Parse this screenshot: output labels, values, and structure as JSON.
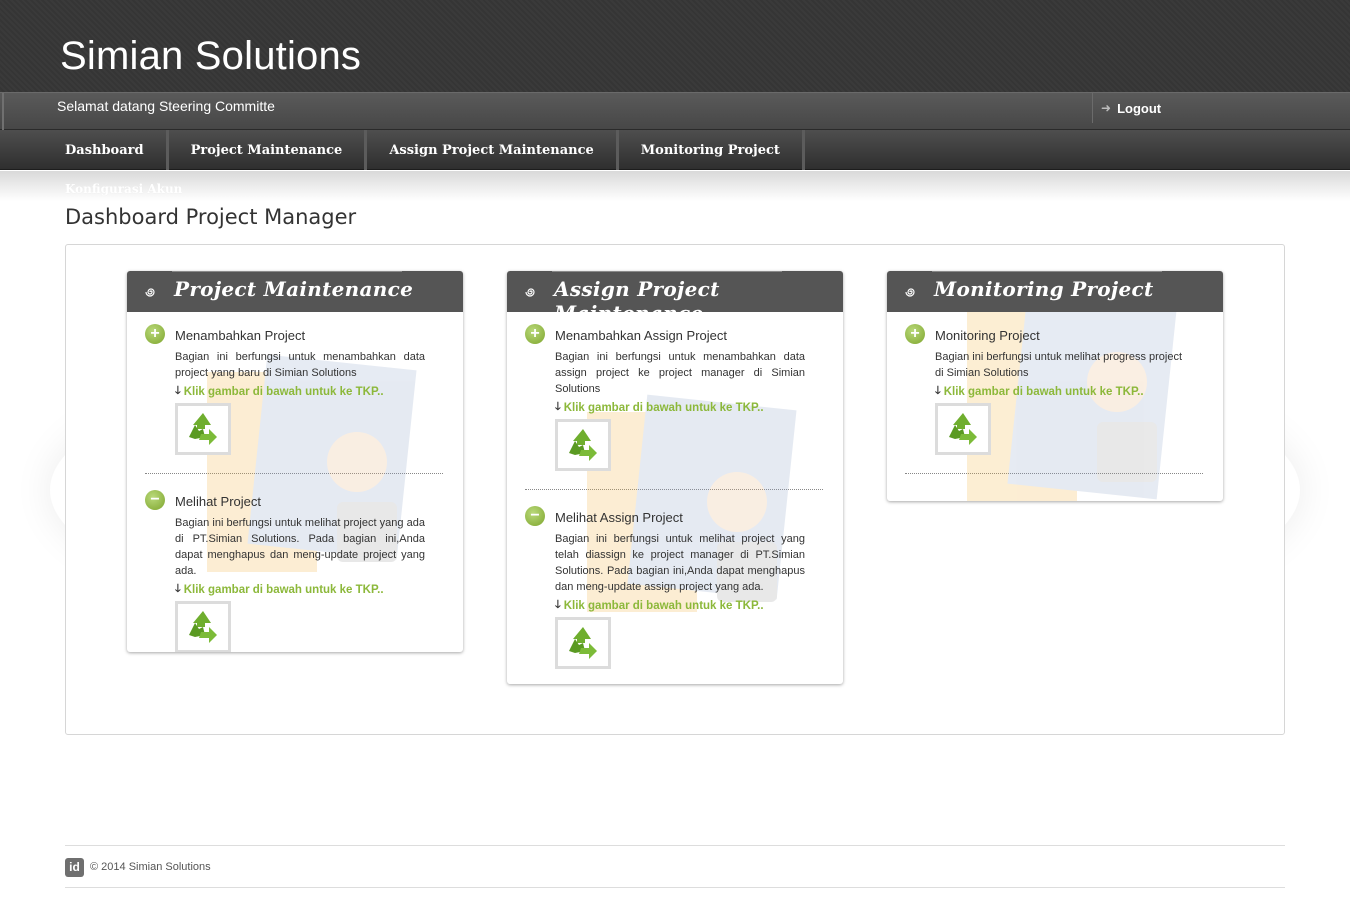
{
  "header": {
    "site_title": "Simian Solutions",
    "welcome": "Selamat datang Steering Committe",
    "logout_label": "Logout"
  },
  "nav": {
    "items": [
      {
        "label": "Dashboard"
      },
      {
        "label": "Project Maintenance"
      },
      {
        "label": "Assign Project Maintenance"
      },
      {
        "label": "Monitoring Project"
      }
    ],
    "submenu": "Konfigurasi Akun"
  },
  "page": {
    "title": "Dashboard Project Manager"
  },
  "panels": [
    {
      "title": "Project Maintenance",
      "sections": [
        {
          "icon": "plus",
          "title": "Menambahkan Project",
          "desc": "Bagian ini berfungsi untuk menambahkan data project yang baru di Simian Solutions",
          "link": "Klik gambar di bawah untuk ke TKP.."
        },
        {
          "icon": "minus",
          "title": "Melihat Project",
          "desc": "Bagian ini berfungsi untuk melihat project yang ada di PT.Simian Solutions. Pada bagian ini,Anda dapat menghapus dan meng-update project yang ada.",
          "link": "Klik gambar di bawah untuk ke TKP.."
        }
      ]
    },
    {
      "title": "Assign Project Maintenance",
      "sections": [
        {
          "icon": "plus",
          "title": "Menambahkan Assign Project",
          "desc": "Bagian ini berfungsi untuk menambahkan data assign project ke project manager di Simian Solutions",
          "link": "Klik gambar di bawah untuk ke TKP.."
        },
        {
          "icon": "minus",
          "title": "Melihat Assign Project",
          "desc": "Bagian ini berfungsi untuk melihat project yang telah diassign ke project manager di PT.Simian Solutions. Pada bagian ini,Anda dapat menghapus dan meng-update assign project yang ada.",
          "link": "Klik gambar di bawah untuk ke TKP.."
        }
      ]
    },
    {
      "title": "Monitoring Project",
      "sections": [
        {
          "icon": "plus",
          "title": "Monitoring Project",
          "desc": "Bagian ini berfungsi untuk melihat progress project di Simian Solutions",
          "link": "Klik gambar di bawah untuk ke TKP.."
        }
      ]
    }
  ],
  "footer": {
    "logo_text": "id",
    "copyright": "© 2014 Simian Solutions"
  },
  "colors": {
    "accent_green": "#8cb83a",
    "header_dark": "#3a3a3a",
    "panel_head": "#555555"
  }
}
